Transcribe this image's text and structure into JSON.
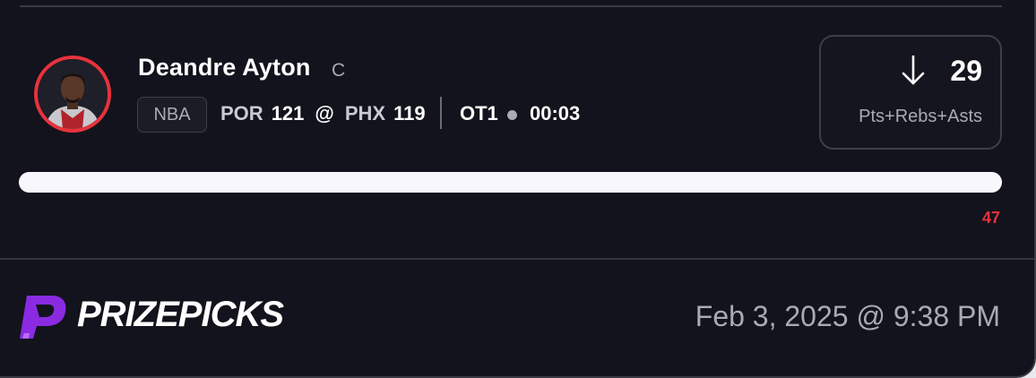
{
  "player": {
    "name": "Deandre Ayton",
    "position": "C",
    "avatar_icon": "player-headshot-icon",
    "avatar_ring_color": "#e8323c"
  },
  "game": {
    "league": "NBA",
    "away_team": "POR",
    "away_score": "121",
    "separator": "@",
    "home_team": "PHX",
    "home_score": "119",
    "period": "OT1",
    "clock": "00:03"
  },
  "projection": {
    "direction_icon": "arrow-down-icon",
    "line": "29",
    "stat_type": "Pts+Rebs+Asts"
  },
  "result": {
    "actual": "47",
    "progress_fraction": 1.0,
    "actual_color": "#e8323c"
  },
  "footer": {
    "brand_name": "PRIZEPICKS",
    "brand_icon": "prizepicks-logo-icon",
    "brand_color": "#8a2be2",
    "timestamp": "Feb 3, 2025 @ 9:38 PM"
  }
}
